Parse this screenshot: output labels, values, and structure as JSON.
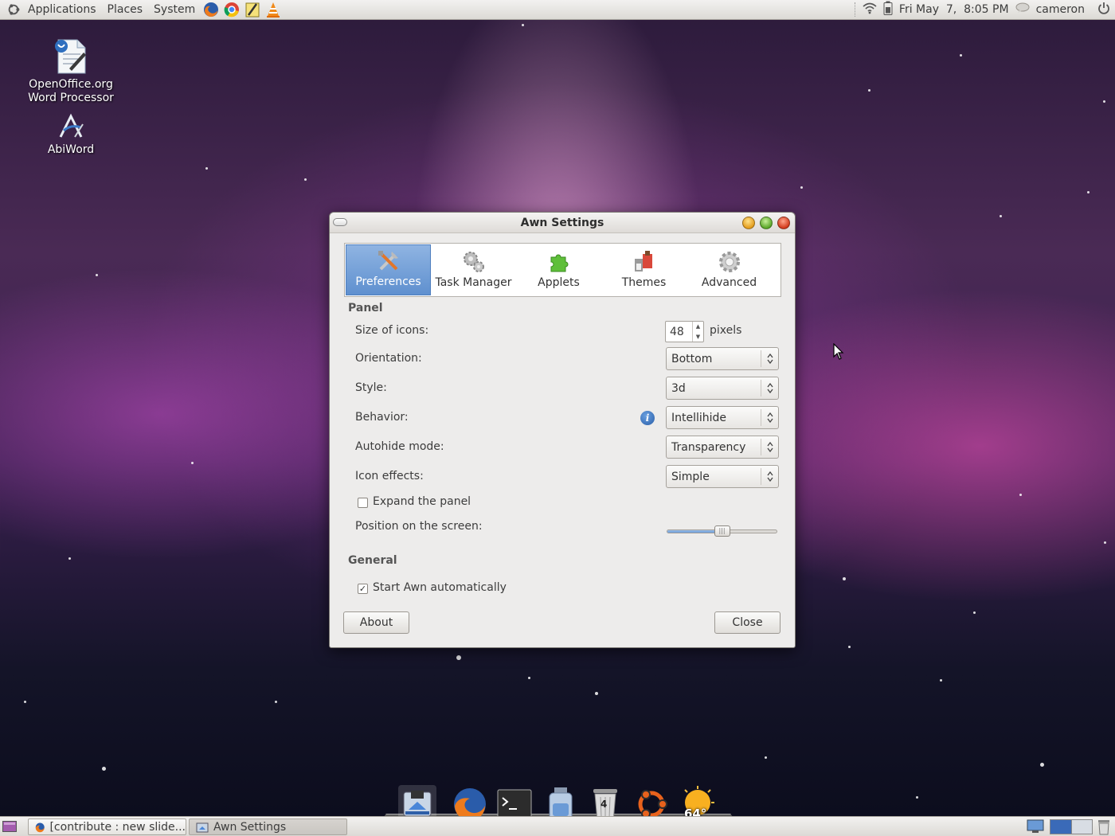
{
  "top_panel": {
    "menus": [
      "Applications",
      "Places",
      "System"
    ],
    "launchers": [
      "firefox-icon",
      "chrome-icon",
      "notes-icon",
      "vlc-icon"
    ],
    "clock": "Fri May  7,  8:05 PM",
    "user": "cameron"
  },
  "desktop": {
    "icons": [
      {
        "label": "OpenOffice.org Word Processor",
        "line1": "OpenOffice.org",
        "line2": "Word Processor"
      },
      {
        "label": "AbiWord"
      }
    ]
  },
  "window": {
    "title": "Awn Settings",
    "tabs": [
      {
        "label": "Preferences",
        "icon": "preferences-tools-icon",
        "active": true
      },
      {
        "label": "Task Manager",
        "icon": "gears-icon",
        "active": false
      },
      {
        "label": "Applets",
        "icon": "puzzle-icon",
        "active": false
      },
      {
        "label": "Themes",
        "icon": "themes-icon",
        "active": false
      },
      {
        "label": "Advanced",
        "icon": "gear-icon",
        "active": false
      }
    ],
    "panel_section": {
      "title": "Panel",
      "size_label": "Size of icons:",
      "size_value": "48",
      "size_unit": "pixels",
      "orientation_label": "Orientation:",
      "orientation_value": "Bottom",
      "style_label": "Style:",
      "style_value": "3d",
      "behavior_label": "Behavior:",
      "behavior_value": "Intellihide",
      "autohide_label": "Autohide mode:",
      "autohide_value": "Transparency",
      "effects_label": "Icon effects:",
      "effects_value": "Simple",
      "expand_label": "Expand the panel",
      "expand_checked": false,
      "position_label": "Position on the screen:",
      "position_fraction": 0.5
    },
    "general_section": {
      "title": "General",
      "autostart_label": "Start Awn automatically",
      "autostart_checked": true
    },
    "about_label": "About",
    "close_label": "Close"
  },
  "dock": {
    "items": [
      "awn-settings-icon",
      "firefox-icon",
      "terminal-icon",
      "jar-icon",
      "trash-icon",
      "ubuntu-icon",
      "weather-icon"
    ],
    "trash_count": "4",
    "weather_temp": "64°"
  },
  "bottom_panel": {
    "tasks": [
      {
        "label": "[contribute : new slide..."
      },
      {
        "label": "Awn Settings"
      }
    ]
  }
}
